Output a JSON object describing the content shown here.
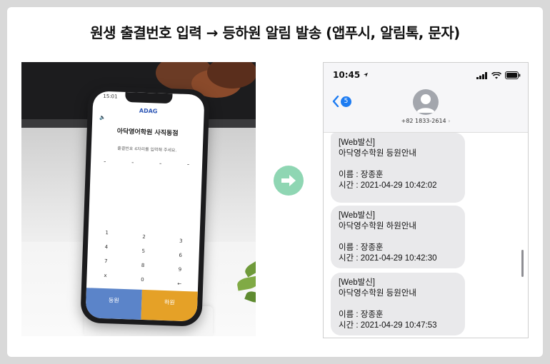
{
  "headline": "원생 출결번호 입력 → 등하원 알림 발송 (앱푸시, 알림톡, 문자)",
  "photo": {
    "phone": {
      "status_time": "15:01",
      "app_logo": "ADAG",
      "academy_name": "아닥영어학원 사직동점",
      "prompt": "출결번호 4자리를 입력해 주세요.",
      "dashes": [
        "-",
        "-",
        "-",
        "-"
      ],
      "keys": [
        "1",
        "2",
        "3",
        "4",
        "5",
        "6",
        "7",
        "8",
        "9",
        "x",
        "0",
        "←"
      ],
      "checkin_label": "등원",
      "checkout_label": "하원"
    }
  },
  "arrow": {
    "icon": "arrow-right-icon",
    "color": "#8fd6b3"
  },
  "messages": {
    "status_time": "10:45",
    "back_count": "5",
    "contact_number": "+82 1833-2614",
    "bubbles": [
      {
        "lines": [
          "[Web발신]",
          "아닥영수학원 등원안내",
          "",
          "이름 : 장종훈",
          "시간 : 2021-04-29 10:42:02"
        ]
      },
      {
        "lines": [
          "[Web발신]",
          "아닥영수학원 하원안내",
          "",
          "이름 : 장종훈",
          "시간 : 2021-04-29 10:42:30"
        ]
      },
      {
        "lines": [
          "[Web발신]",
          "아닥영수학원 등원안내",
          "",
          "이름 : 장종훈",
          "시간 : 2021-04-29 10:47:53"
        ]
      }
    ]
  },
  "colors": {
    "checkin_button": "#5b84c9",
    "checkout_button": "#e5a127",
    "imessage_blue": "#1d7cf2",
    "bubble_gray": "#e9e9eb"
  }
}
